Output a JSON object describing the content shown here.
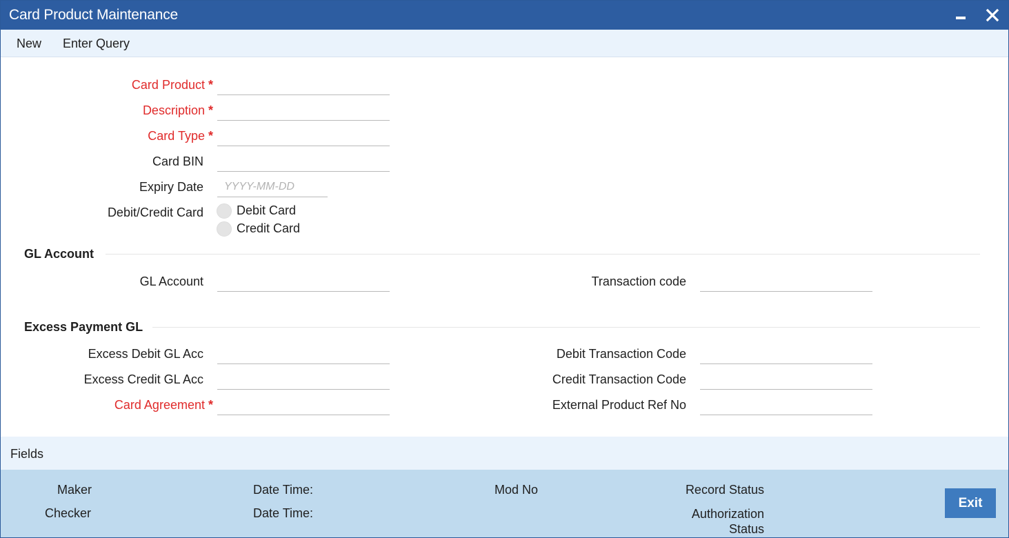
{
  "window": {
    "title": "Card Product Maintenance",
    "minimize_icon": "minimize-icon",
    "close_icon": "close-icon"
  },
  "menu": {
    "new": "New",
    "enter_query": "Enter Query"
  },
  "form": {
    "card_product": {
      "label": "Card Product",
      "required": true,
      "value": ""
    },
    "description": {
      "label": "Description",
      "required": true,
      "value": ""
    },
    "card_type": {
      "label": "Card Type",
      "required": true,
      "value": ""
    },
    "card_bin": {
      "label": "Card BIN",
      "value": ""
    },
    "expiry_date": {
      "label": "Expiry Date",
      "placeholder": "YYYY-MM-DD",
      "value": ""
    },
    "debit_credit": {
      "label": "Debit/Credit Card",
      "options": [
        "Debit Card",
        "Credit Card"
      ],
      "selected": null
    },
    "required_marker": "*"
  },
  "gl_section": {
    "title": "GL Account",
    "gl_account": {
      "label": "GL Account",
      "value": ""
    },
    "transaction_code": {
      "label": "Transaction code",
      "value": ""
    }
  },
  "excess_section": {
    "title": "Excess Payment GL",
    "excess_debit": {
      "label": "Excess Debit GL Acc",
      "value": ""
    },
    "excess_credit": {
      "label": "Excess Credit GL Acc",
      "value": ""
    },
    "card_agreement": {
      "label": "Card Agreement",
      "required": true,
      "value": ""
    },
    "debit_txn_code": {
      "label": "Debit Transaction Code",
      "value": ""
    },
    "credit_txn_code": {
      "label": "Credit Transaction Code",
      "value": ""
    },
    "external_ref": {
      "label": "External Product Ref No",
      "value": ""
    }
  },
  "fields_bar": {
    "label": "Fields"
  },
  "footer": {
    "maker": "Maker",
    "checker": "Checker",
    "date_time_1": "Date Time:",
    "date_time_2": "Date Time:",
    "mod_no": "Mod No",
    "record_status": "Record Status",
    "authorization_status": "Authorization Status",
    "exit": "Exit"
  },
  "colors": {
    "titlebar": "#2d5da1",
    "menubar": "#eaf3fc",
    "footer": "#bfdaee",
    "required": "#e02b2b",
    "exit_button": "#3e7bbf"
  }
}
